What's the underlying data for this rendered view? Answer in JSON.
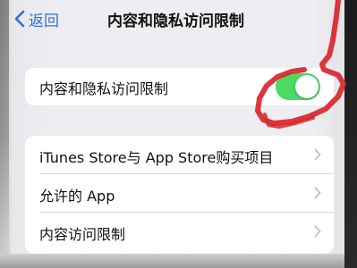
{
  "nav": {
    "back_label": "返回",
    "title": "内容和隐私访问限制"
  },
  "main_toggle": {
    "label": "内容和隐私访问限制",
    "state": "on",
    "color": "#4cd964"
  },
  "list": {
    "items": [
      {
        "label": "iTunes Store与 App Store购买项目"
      },
      {
        "label": "允许的 App"
      },
      {
        "label": "内容访问限制"
      }
    ]
  },
  "colors": {
    "accent": "#2f6ee5",
    "annotation": "#d8262b"
  }
}
